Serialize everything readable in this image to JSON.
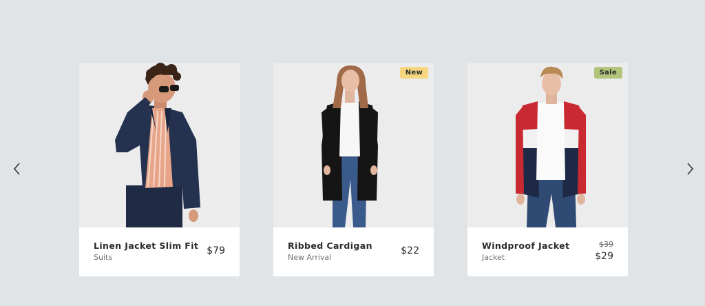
{
  "carousel": {
    "prev_icon": "chevron-left-icon",
    "next_icon": "chevron-right-icon",
    "products": [
      {
        "name": "Linen Jacket Slim Fit",
        "category": "Suits",
        "price": "$79"
      },
      {
        "name": "Ribbed Cardigan",
        "category": "New Arrival",
        "price": "$22",
        "badge": "New"
      },
      {
        "name": "Windproof Jacket",
        "category": "Jacket",
        "old_price": "$39",
        "price": "$29",
        "badge": "Sale"
      }
    ]
  },
  "colors": {
    "background": "#e0e4e7",
    "card": "#ffffff",
    "badge_new": "#f6d77f",
    "badge_sale": "#b2c57c",
    "text_primary": "#2a2a2a",
    "text_secondary": "#6f6f6f"
  }
}
